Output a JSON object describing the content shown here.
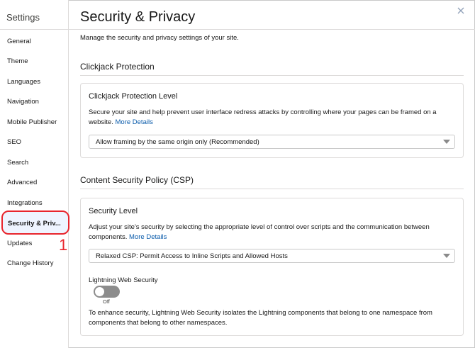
{
  "sidebar": {
    "title": "Settings",
    "items": [
      {
        "label": "General"
      },
      {
        "label": "Theme"
      },
      {
        "label": "Languages"
      },
      {
        "label": "Navigation"
      },
      {
        "label": "Mobile Publisher"
      },
      {
        "label": "SEO"
      },
      {
        "label": "Search"
      },
      {
        "label": "Advanced"
      },
      {
        "label": "Integrations"
      },
      {
        "label": "Security & Priv..."
      },
      {
        "label": "Updates"
      },
      {
        "label": "Change History"
      }
    ],
    "selected": "Security & Priv...",
    "callout_number": "1"
  },
  "header": {
    "title": "Security & Privacy",
    "close_icon": "close-icon",
    "description": "Manage the security and privacy settings of your site."
  },
  "clickjack": {
    "section_title": "Clickjack Protection",
    "card_title": "Clickjack Protection Level",
    "text": "Secure your site and help prevent user interface redress attacks by controlling where your pages can be framed on a website.",
    "link": "More Details",
    "select_value": "Allow framing by the same origin only (Recommended)"
  },
  "csp": {
    "section_title": "Content Security Policy (CSP)",
    "card_title": "Security Level",
    "text": "Adjust your site's security by selecting the appropriate level of control over scripts and the communication between components.",
    "link": "More Details",
    "select_value": "Relaxed CSP: Permit Access to Inline Scripts and Allowed Hosts",
    "lws_label": "Lightning Web Security",
    "lws_state": "Off",
    "lws_description": "To enhance security, Lightning Web Security isolates the Lightning components that belong to one namespace from components that belong to other namespaces."
  },
  "colors": {
    "highlight": "#e8252d",
    "link": "#0b5cab",
    "toggle_off": "#8c8c8c"
  }
}
